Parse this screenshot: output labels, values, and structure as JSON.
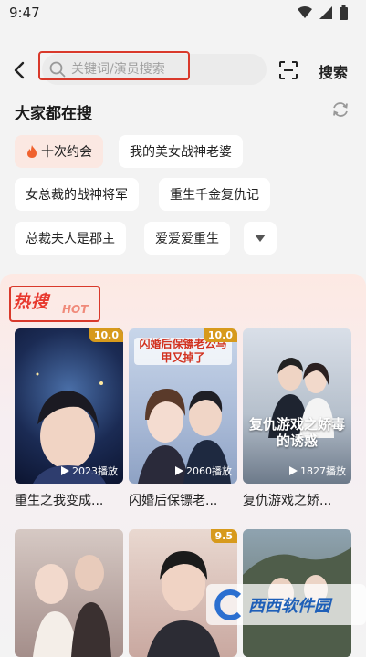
{
  "status": {
    "time": "9:47"
  },
  "search": {
    "placeholder": "关键词/演员搜索",
    "button_label": "搜索"
  },
  "trending": {
    "title": "大家都在搜",
    "tags": [
      "十次约会",
      "我的美女战神老婆",
      "女总裁的战神将军",
      "重生千金复仇记",
      "总裁夫人是郡主",
      "爱爱爱重生"
    ]
  },
  "hot": {
    "title": "热搜",
    "title_en": "HOT",
    "items": [
      {
        "name": "重生之我变成...",
        "poster_text": "",
        "score": "10.0",
        "plays": "2023播放"
      },
      {
        "name": "闪婚后保镖老...",
        "poster_text": "闪婚后保镖老公马甲又掉了",
        "score": "10.0",
        "plays": "2060播放"
      },
      {
        "name": "复仇游戏之娇...",
        "poster_text": "复仇游戏之娇毒的诱惑",
        "score": "",
        "plays": "1827播放"
      }
    ],
    "row2": [
      {
        "score": ""
      },
      {
        "score": "9.5"
      },
      {
        "score": ""
      }
    ]
  },
  "watermark": {
    "name": "西西软件园"
  },
  "colors": {
    "accent": "#e8392e",
    "score_bg": "#d79a1c",
    "highlight": "#d9392b"
  }
}
